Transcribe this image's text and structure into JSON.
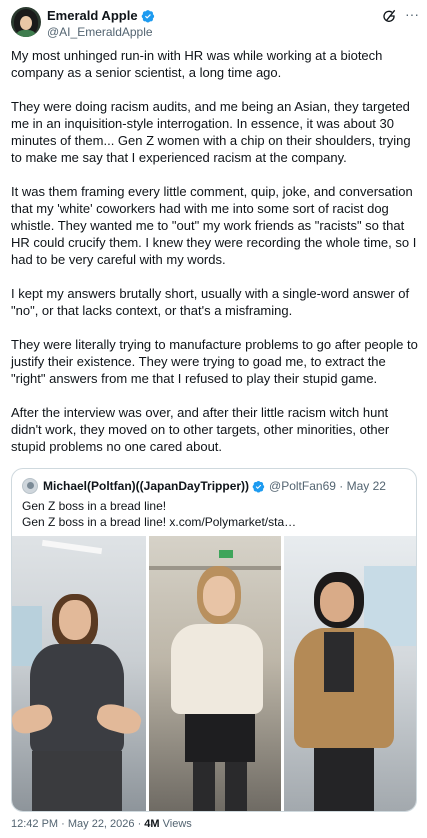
{
  "author": {
    "display_name": "Emerald Apple",
    "handle": "@AI_EmeraldApple",
    "verified_icon": "verified-badge-icon",
    "verified_color": "#1d9bf0"
  },
  "actions": {
    "grok_icon": "grok-icon",
    "more_label": "···"
  },
  "tweet": {
    "paragraphs": [
      "My most unhinged run-in with HR was while working at a biotech company as a senior scientist, a long time ago.",
      "They were doing racism audits, and me being an Asian, they targeted me in an inquisition-style interrogation. In essence, it was about 30 minutes of them... Gen Z women with a chip on their shoulders, trying to make me say that I experienced racism at the company.",
      "It was them framing every little comment, quip, joke, and conversation that my 'white' coworkers had with me into some sort of racist dog whistle. They wanted me to \"out\" my work friends as \"racists\" so that HR could crucify them. I knew they were recording the whole time, so I had to be very careful with my words.",
      "I kept my answers brutally short, usually with a single-word answer of \"no\", or that lacks context, or that's a misframing.",
      "They were literally trying to manufacture problems to go after people to justify their existence. They were trying to goad me, to extract the \"right\" answers from me that I refused to play their stupid game.",
      "After the interview was over, and after their little racism witch hunt didn't work, they moved on to other targets, other minorities, other stupid problems no one cared about."
    ]
  },
  "quote": {
    "display_name": "Michael(Poltfan)((JapanDayTripper))",
    "handle": "@PoltFan69",
    "date": "May 22",
    "handle_date": "@PoltFan69 · May 22",
    "line1": "Gen Z boss in a bread line!",
    "line2": "Gen Z boss in a bread line!  x.com/Polymarket/sta…",
    "images": [
      "video-frame-1",
      "video-frame-2",
      "video-frame-3"
    ]
  },
  "meta": {
    "time_date": "12:42 PM · May 22, 2026 · ",
    "views_count": "4M",
    "views_label": " Views"
  }
}
